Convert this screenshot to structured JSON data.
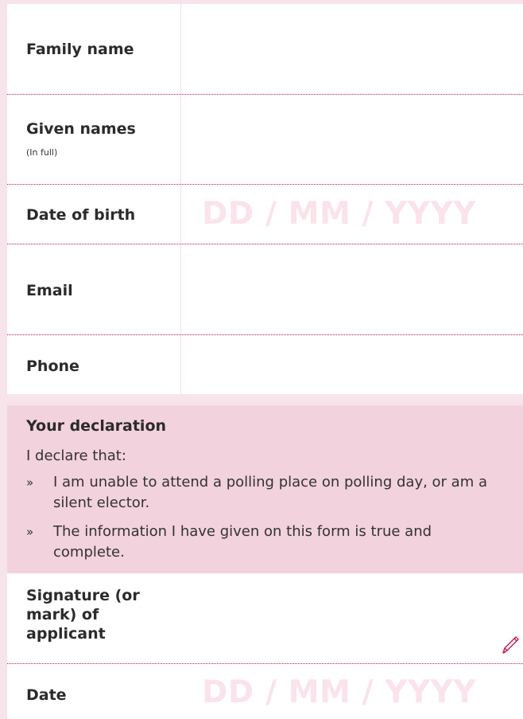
{
  "fields": {
    "family_name_label": "Family name",
    "given_names_label": "Given names",
    "given_names_hint": "(In full)",
    "date_of_birth_label": "Date of birth",
    "date_of_birth_placeholder": "DD / MM / YYYY",
    "email_label": "Email",
    "phone_label": "Phone"
  },
  "declaration": {
    "title": "Your declaration",
    "intro": "I declare that:",
    "bullet_mark": "»",
    "items": [
      "I am unable to attend a polling place on polling day, or am a silent elector.",
      "The information I have given on this form is true and complete."
    ]
  },
  "signature": {
    "label": "Signature (or mark) of applicant",
    "date_label": "Date",
    "date_placeholder": "DD / MM / YYYY",
    "pencil_icon": "pencil-icon"
  },
  "colors": {
    "background": "#f7e3ea",
    "declaration_bg": "#f2d2dd",
    "divider": "#c2185b",
    "placeholder": "#fbe3ea",
    "pencil": "#c2185b"
  }
}
